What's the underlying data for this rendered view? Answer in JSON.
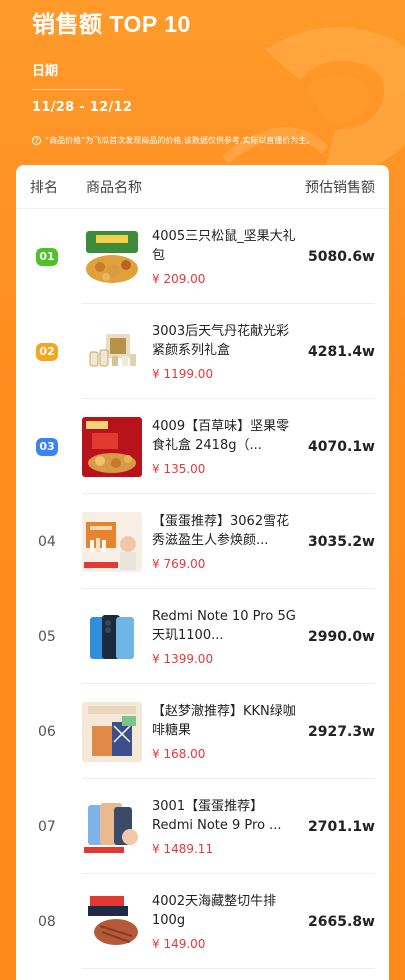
{
  "header": {
    "title": "销售额 TOP 10",
    "date_label": "日期",
    "date_range": "11/28 - 12/12",
    "note": "“商品价格”为飞瓜首次发现商品的价格,该数据仅供参考,实际以直播价为主。",
    "note_icon": "?"
  },
  "table": {
    "col_rank": "排名",
    "col_name": "商品名称",
    "col_sales": "预估销售额"
  },
  "medal_colors": [
    "#4fc12a",
    "#f5a623",
    "#3a82f7"
  ],
  "rows": [
    {
      "rank": "01",
      "name": "4005三只松鼠_坚果大礼包",
      "price": "¥ 209.00",
      "sales": "5080.6w"
    },
    {
      "rank": "02",
      "name": "3003后天气丹花献光彩紧颜系列礼盒",
      "price": "¥ 1199.00",
      "sales": "4281.4w"
    },
    {
      "rank": "03",
      "name": "4009【百草味】坚果零食礼盒 2418g（...",
      "price": "¥ 135.00",
      "sales": "4070.1w"
    },
    {
      "rank": "04",
      "name": "【蛋蛋推荐】3062雪花秀滋盈生人参焕颜...",
      "price": "¥ 769.00",
      "sales": "3035.2w"
    },
    {
      "rank": "05",
      "name": "Redmi Note 10 Pro 5G 天玑1100...",
      "price": "¥ 1399.00",
      "sales": "2990.0w"
    },
    {
      "rank": "06",
      "name": "【赵梦澈推荐】KKN绿咖啡糖果",
      "price": "¥ 168.00",
      "sales": "2927.3w"
    },
    {
      "rank": "07",
      "name": "3001【蛋蛋推荐】Redmi Note 9 Pro ...",
      "price": "¥ 1489.11",
      "sales": "2701.1w"
    },
    {
      "rank": "08",
      "name": "4002天海藏整切牛排100g",
      "price": "¥ 149.00",
      "sales": "2665.8w"
    }
  ]
}
